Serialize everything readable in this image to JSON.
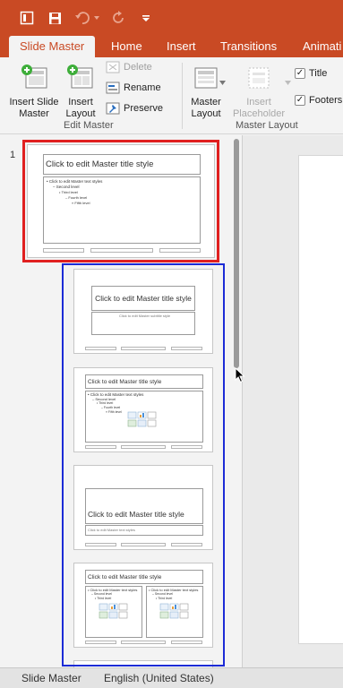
{
  "qat": {
    "icons": [
      "slide-master-icon",
      "save-icon",
      "undo-icon",
      "redo-icon",
      "customize-toolbar-icon"
    ]
  },
  "tabs": [
    {
      "label": "Slide Master",
      "active": true
    },
    {
      "label": "Home"
    },
    {
      "label": "Insert"
    },
    {
      "label": "Transitions"
    },
    {
      "label": "Animati"
    }
  ],
  "ribbon": {
    "insert_slide_master": "Insert Slide Master",
    "insert_layout": "Insert Layout",
    "delete": "Delete",
    "rename": "Rename",
    "preserve": "Preserve",
    "edit_master_group": "Edit Master",
    "master_layout": "Master Layout",
    "insert_placeholder": "Insert Placeholder",
    "title_checkbox": "Title",
    "footers_checkbox": "Footers",
    "master_layout_group": "Master Layout"
  },
  "thumbnails": {
    "slide_number": "1",
    "master_title": "Click to edit Master title style",
    "master_text": "Click to edit Master text styles",
    "level2": "Second level",
    "level3": "Third level",
    "level4": "Fourth level",
    "level5": "Fifth level",
    "subtitle": "Click to edit Master subtitle style",
    "text_small": "Click to edit Master text styles"
  },
  "status": {
    "view": "Slide Master",
    "language": "English (United States)"
  },
  "colors": {
    "accent": "#c94a24",
    "red_frame": "#e02020",
    "blue_frame": "#1c2bd6"
  }
}
